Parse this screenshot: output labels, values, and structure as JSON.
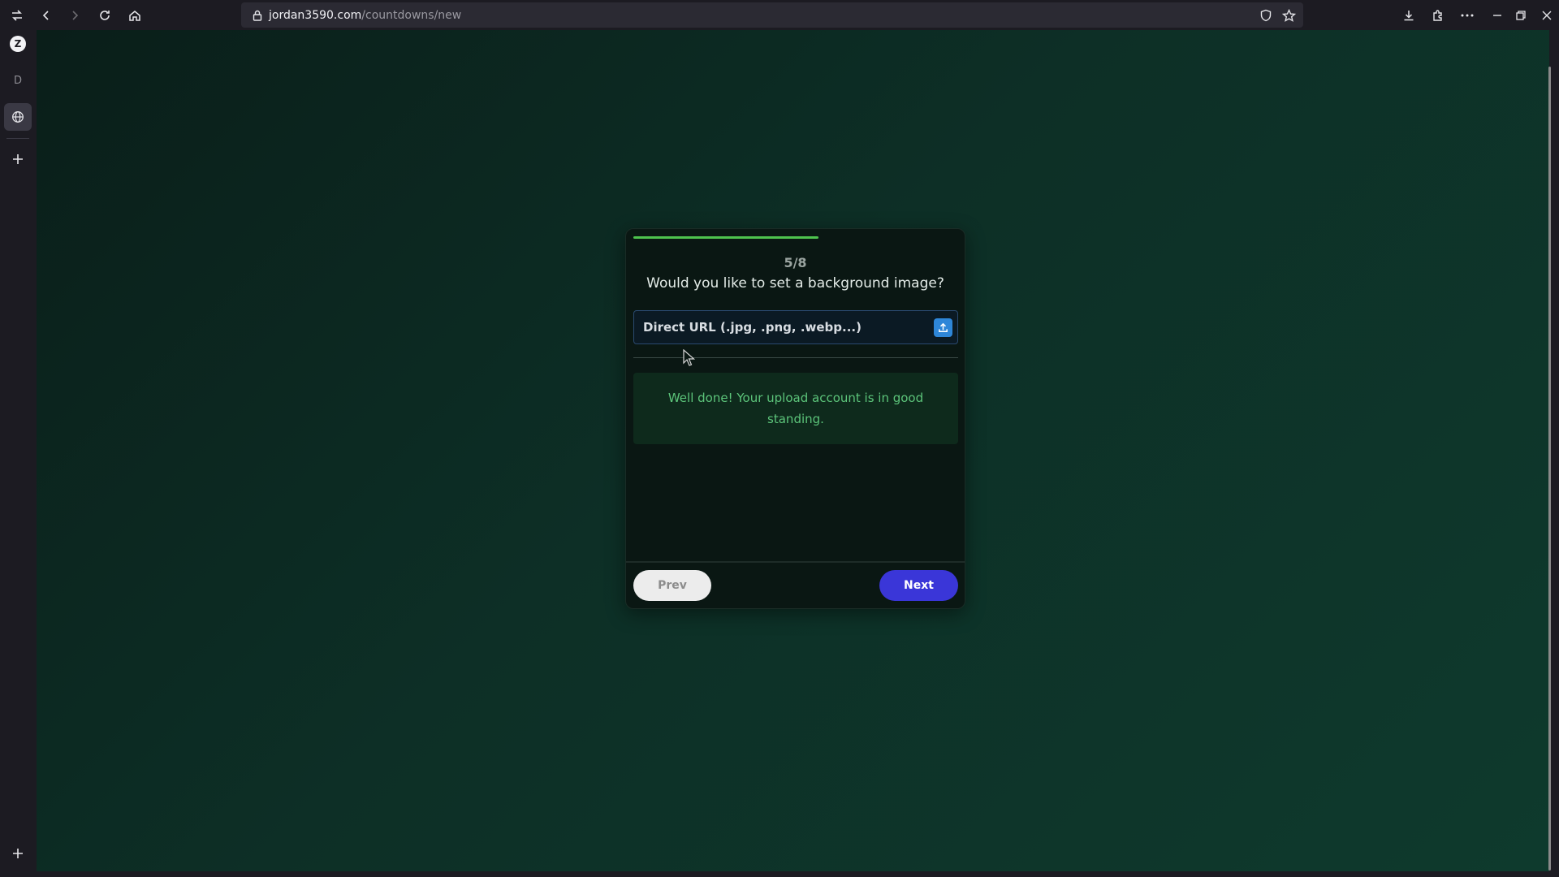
{
  "browser": {
    "url_host": "jordan3590.com",
    "url_path": "/countdowns/new",
    "icons": [
      "sidebar-toggle-icon",
      "back-icon",
      "forward-icon",
      "reload-icon",
      "home-icon",
      "lock-icon",
      "shield-icon",
      "bookmark-star-icon",
      "download-icon",
      "extensions-icon",
      "menu-more-icon",
      "minimize-icon",
      "restore-icon",
      "close-icon"
    ]
  },
  "sidebar": {
    "avatar_letter": "Z",
    "tab_letter": "D"
  },
  "wizard": {
    "progress": 0.57,
    "step": "5/8",
    "question": "Would you like to set a background image?",
    "url_placeholder": "Direct URL (.jpg, .png, .webp...)",
    "alert": "Well done! Your upload account is in good standing.",
    "prev_label": "Prev",
    "next_label": "Next"
  },
  "colors": {
    "accent_next": "#3a36d8",
    "progress": "#4ec34e",
    "alert_text": "#5cc47a"
  }
}
